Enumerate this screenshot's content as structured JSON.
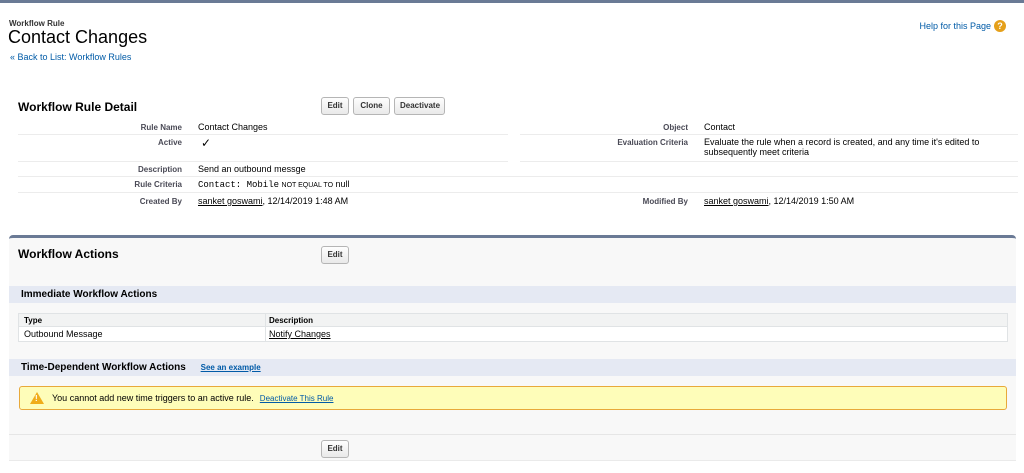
{
  "header": {
    "page_type": "Workflow Rule",
    "title": "Contact Changes",
    "back_link": "« Back to List: Workflow Rules",
    "help_link": "Help for this Page",
    "help_icon": "?"
  },
  "detail": {
    "heading": "Workflow Rule Detail",
    "buttons": {
      "edit": "Edit",
      "clone": "Clone",
      "deactivate": "Deactivate"
    },
    "fields": {
      "rule_name_label": "Rule Name",
      "rule_name": "Contact Changes",
      "active_label": "Active",
      "active_check": "✓",
      "description_label": "Description",
      "description": "Send an outbound messge",
      "rule_criteria_label": "Rule Criteria",
      "rule_criteria_field": "Contact: Mobile",
      "rule_criteria_operator": "NOT EQUAL TO",
      "rule_criteria_value": "null",
      "created_by_label": "Created By",
      "created_by_user": "sanket goswami",
      "created_by_date": ", 12/14/2019 1:48 AM",
      "object_label": "Object",
      "object": "Contact",
      "evaluation_label": "Evaluation Criteria",
      "evaluation_line1": "Evaluate the rule when a record is created, and any time it's edited to",
      "evaluation_line2": "subsequently meet criteria",
      "modified_by_label": "Modified By",
      "modified_by_user": "sanket goswami",
      "modified_by_date": ", 12/14/2019 1:50 AM"
    }
  },
  "actions": {
    "heading": "Workflow Actions",
    "edit_label": "Edit",
    "immediate_heading": "Immediate Workflow Actions",
    "table": {
      "col_type": "Type",
      "col_description": "Description",
      "rows": [
        {
          "type": "Outbound Message",
          "description": "Notify Changes"
        }
      ]
    },
    "time_dependent_heading": "Time-Dependent Workflow Actions",
    "see_example": "See an example",
    "warning_text": "You cannot add new time triggers to an active rule.",
    "warning_link": "Deactivate This Rule",
    "bottom_edit_label": "Edit"
  },
  "colors": {
    "link": "#015ba7",
    "section_border": "#6a7a95",
    "subhead_bg": "#e5e9f3",
    "warning_bg": "#fefdb9",
    "warning_border": "#e8a93a"
  }
}
